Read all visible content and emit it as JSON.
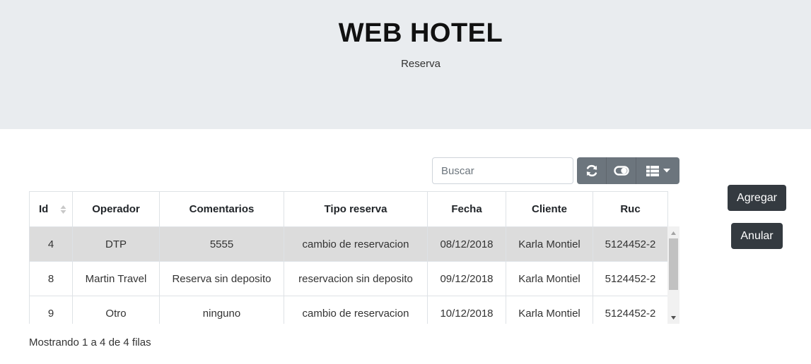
{
  "header": {
    "title": "WEB HOTEL",
    "subtitle": "Reserva"
  },
  "toolbar": {
    "search_placeholder": "Buscar",
    "refresh_icon": "refresh-icon",
    "toggle_icon": "toggle-view-icon",
    "columns_icon": "columns-list-icon"
  },
  "table": {
    "columns": [
      "Id",
      "Operador",
      "Comentarios",
      "Tipo reserva",
      "Fecha",
      "Cliente",
      "Ruc"
    ],
    "rows": [
      [
        "4",
        "DTP",
        "5555",
        "cambio de reservacion",
        "08/12/2018",
        "Karla Montiel",
        "5124452-2"
      ],
      [
        "8",
        "Martin Travel",
        "Reserva sin deposito",
        "reservacion sin deposito",
        "09/12/2018",
        "Karla Montiel",
        "5124452-2"
      ],
      [
        "9",
        "Otro",
        "ninguno",
        "cambio de reservacion",
        "10/12/2018",
        "Karla Montiel",
        "5124452-2"
      ]
    ]
  },
  "pagination": {
    "info": "Mostrando 1 a 4 de 4 filas"
  },
  "actions": {
    "add_label": "Agregar",
    "cancel_label": "Anular"
  },
  "colors": {
    "jumbotron_bg": "#e9ecef",
    "toolbar_bg": "#6c757d",
    "dark_button_bg": "#343a40",
    "selected_row_bg": "#dcdcdc"
  }
}
